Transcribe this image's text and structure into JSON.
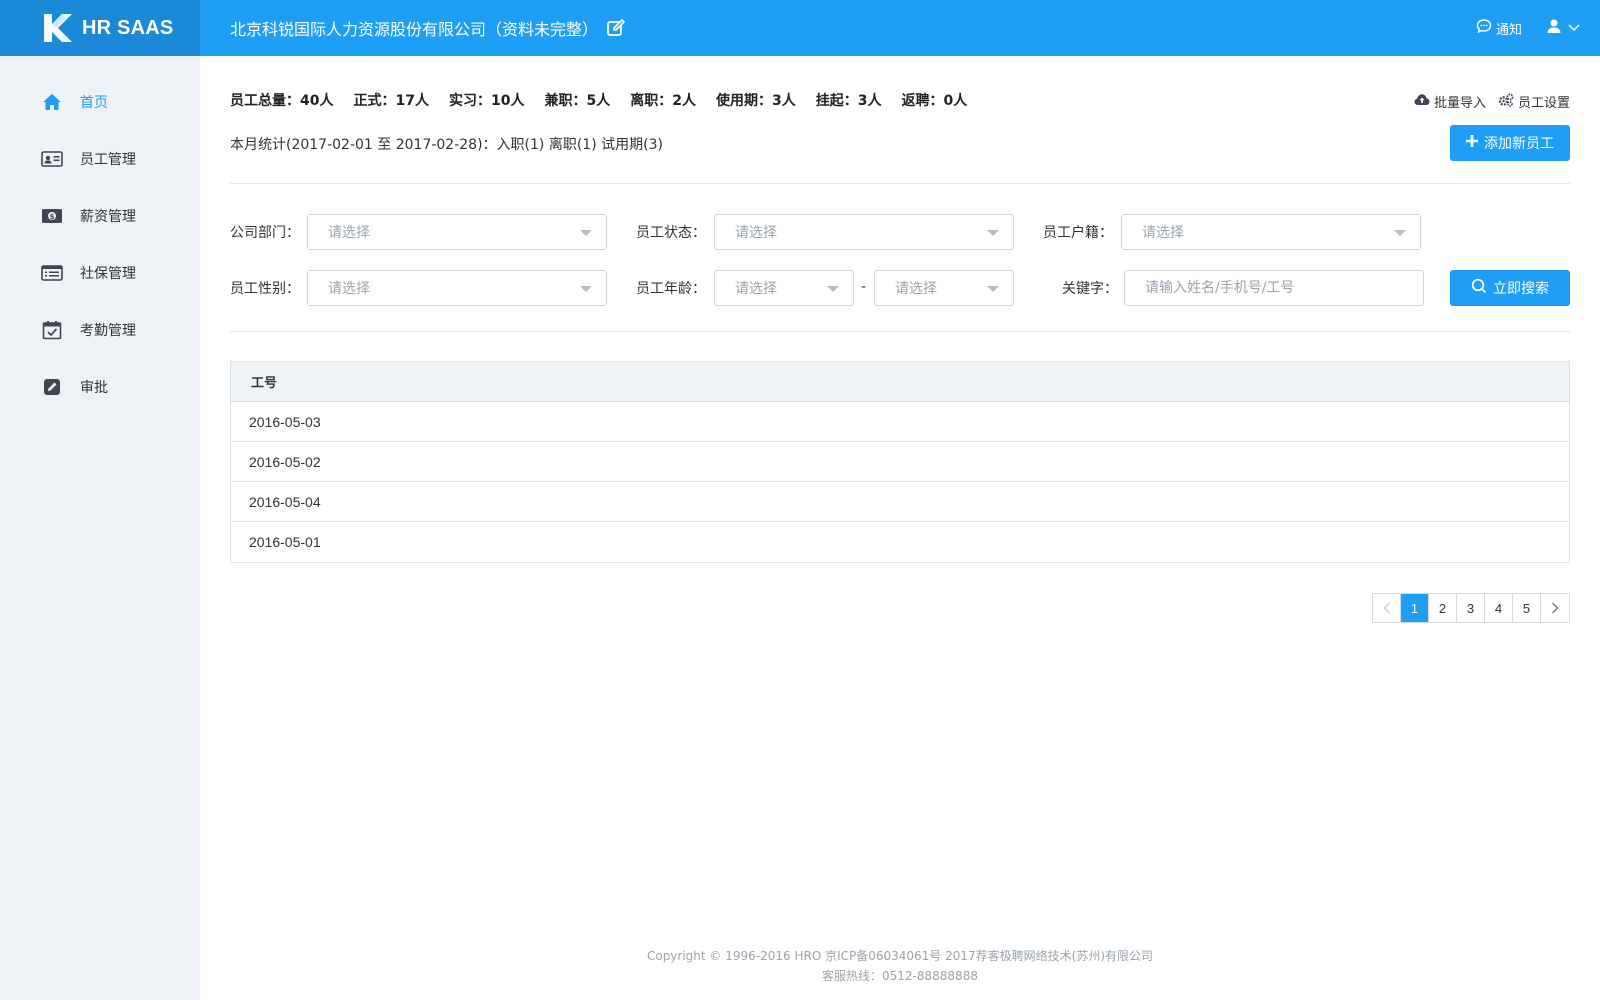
{
  "header": {
    "logo_text": "HR SAAS",
    "company_name": "北京科锐国际人力资源股份有限公司（资料未完整）",
    "notify_label": "通知"
  },
  "sidebar": {
    "items": [
      {
        "label": "首页",
        "icon": "home-icon",
        "active": true
      },
      {
        "label": "员工管理",
        "icon": "id-card-icon",
        "active": false
      },
      {
        "label": "薪资管理",
        "icon": "money-icon",
        "active": false
      },
      {
        "label": "社保管理",
        "icon": "list-card-icon",
        "active": false
      },
      {
        "label": "考勤管理",
        "icon": "calendar-check-icon",
        "active": false
      },
      {
        "label": "审批",
        "icon": "edit-icon",
        "active": false
      }
    ]
  },
  "stats": {
    "total": "员工总量：40人",
    "formal": "正式：17人",
    "intern": "实习：10人",
    "parttime": "兼职：5人",
    "left": "离职：2人",
    "probation": "使用期：3人",
    "suspended": "挂起：3人",
    "rehired": "返聘：0人"
  },
  "month_stats": "本月统计(2017-02-01 至 2017-02-28)：入职(1) 离职(1) 试用期(3)",
  "actions": {
    "import_label": "批量导入",
    "settings_label": "员工设置",
    "add_label": "添加新员工"
  },
  "filters": {
    "department_label": "公司部门：",
    "status_label": "员工状态：",
    "hukou_label": "员工户籍：",
    "gender_label": "员工性别：",
    "age_label": "员工年龄：",
    "keyword_label": "关键字：",
    "select_placeholder": "请选择",
    "keyword_placeholder": "请输入姓名/手机号/工号",
    "age_separator": "-",
    "search_label": "立即搜索"
  },
  "table": {
    "header": "工号",
    "rows": [
      "2016-05-03",
      "2016-05-02",
      "2016-05-04",
      "2016-05-01"
    ]
  },
  "pagination": {
    "pages": [
      "1",
      "2",
      "3",
      "4",
      "5"
    ],
    "current": "1"
  },
  "footer": {
    "copyright": "Copyright © 1996-2016 HRO 京ICP备06034061号 2017荐客极聘网络技术(苏州)有限公司",
    "hotline": "客服热线：0512-88888888"
  },
  "colors": {
    "primary": "#1e9ff5",
    "sidebar_bg": "#eef1f6"
  }
}
